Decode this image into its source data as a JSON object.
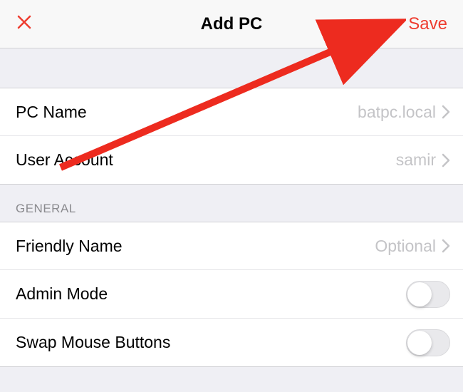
{
  "header": {
    "title": "Add PC",
    "save_label": "Save"
  },
  "top_section": {
    "rows": [
      {
        "label": "PC Name",
        "value": "batpc.local"
      },
      {
        "label": "User Account",
        "value": "samir"
      }
    ]
  },
  "general_section": {
    "title": "GENERAL",
    "rows": [
      {
        "label": "Friendly Name",
        "value": "Optional",
        "type": "nav"
      },
      {
        "label": "Admin Mode",
        "type": "toggle",
        "on": false
      },
      {
        "label": "Swap Mouse Buttons",
        "type": "toggle",
        "on": false
      }
    ]
  },
  "colors": {
    "accent": "#ee3c2f",
    "secondary_text": "#c4c4c7",
    "bg": "#efeff4"
  }
}
